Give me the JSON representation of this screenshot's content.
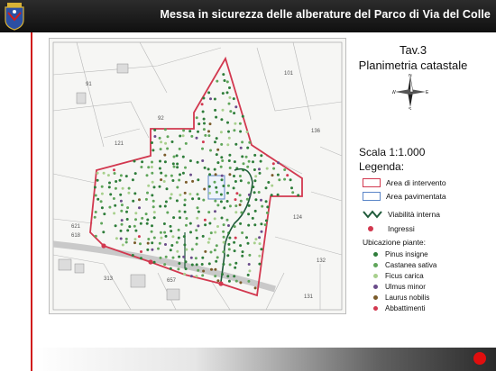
{
  "header": {
    "title": "Messa in sicurezza delle alberature del Parco di Via del Colle"
  },
  "panel": {
    "tav": "Tav.3",
    "subtitle": "Planimetria catastale",
    "compass": {
      "n": "N",
      "s": "S",
      "e": "E",
      "w": "W"
    },
    "scale": "Scala 1:1.000",
    "legend_title": "Legenda:",
    "legend": [
      {
        "label": "Area di intervento",
        "color": "#d2384f"
      },
      {
        "label": "Area pavimentata",
        "color": "#5b86c8"
      },
      {
        "label": "Viabilità interna",
        "color": "#1f5a3a"
      },
      {
        "label": "Ingressi",
        "color": "#d2384f"
      }
    ],
    "species_title": "Ubicazione piante:",
    "species": [
      {
        "label": "Pinus insigne",
        "color": "#2e7d3a"
      },
      {
        "label": "Castanea sativa",
        "color": "#5fa55a"
      },
      {
        "label": "Ficus carica",
        "color": "#a8d08d"
      },
      {
        "label": "Ulmus minor",
        "color": "#6a4c8a"
      },
      {
        "label": "Laurus nobilis",
        "color": "#7a5b2a"
      },
      {
        "label": "Abbattimenti",
        "color": "#d2384f"
      }
    ]
  },
  "map": {
    "parcel_numbers": [
      "121",
      "124",
      "132",
      "136",
      "91",
      "92",
      "101",
      "131",
      "124",
      "143",
      "621",
      "618",
      "657",
      "313"
    ]
  },
  "colors": {
    "accent": "#d11c1c",
    "boundary": "#d2384f",
    "path": "#1f5a3a"
  }
}
